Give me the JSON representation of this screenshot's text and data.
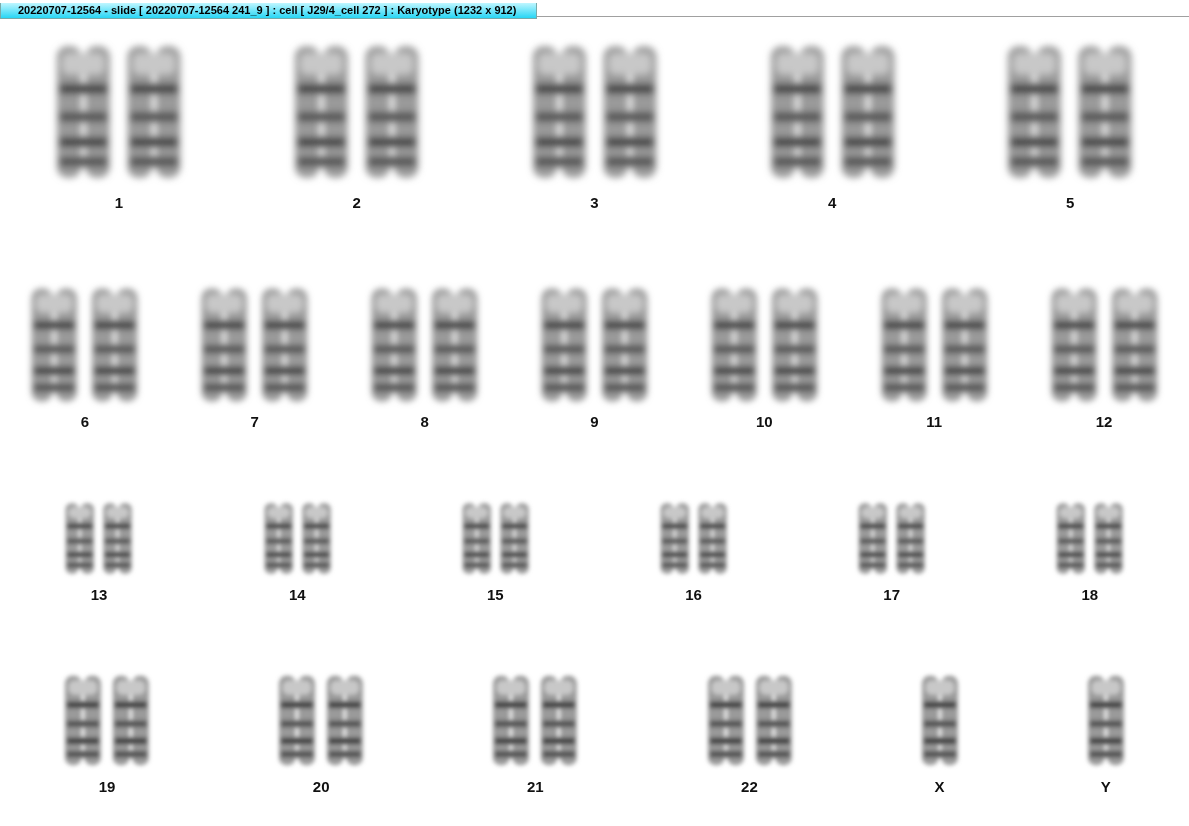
{
  "window": {
    "title": "20220707-12564 - slide [ 20220707-12564 241_9 ] : cell [ J29/4_cell 272 ] : Karyotype  (1232 x 912)"
  },
  "rows": [
    {
      "chromosomes": [
        {
          "label": "1",
          "kind": "pair"
        },
        {
          "label": "2",
          "kind": "pair"
        },
        {
          "label": "3",
          "kind": "pair"
        },
        {
          "label": "4",
          "kind": "pair"
        },
        {
          "label": "5",
          "kind": "pair"
        }
      ]
    },
    {
      "chromosomes": [
        {
          "label": "6",
          "kind": "pair"
        },
        {
          "label": "7",
          "kind": "pair"
        },
        {
          "label": "8",
          "kind": "pair"
        },
        {
          "label": "9",
          "kind": "pair"
        },
        {
          "label": "10",
          "kind": "pair"
        },
        {
          "label": "11",
          "kind": "pair"
        },
        {
          "label": "12",
          "kind": "pair"
        }
      ]
    },
    {
      "chromosomes": [
        {
          "label": "13",
          "kind": "pair"
        },
        {
          "label": "14",
          "kind": "pair"
        },
        {
          "label": "15",
          "kind": "pair"
        },
        {
          "label": "16",
          "kind": "pair"
        },
        {
          "label": "17",
          "kind": "pair"
        },
        {
          "label": "18",
          "kind": "pair"
        }
      ]
    },
    {
      "chromosomes": [
        {
          "label": "19",
          "kind": "pair"
        },
        {
          "label": "20",
          "kind": "pair"
        },
        {
          "label": "21",
          "kind": "pair"
        },
        {
          "label": "22",
          "kind": "pair"
        },
        {
          "label": "X",
          "kind": "single"
        },
        {
          "label": "Y",
          "kind": "single"
        }
      ]
    }
  ]
}
